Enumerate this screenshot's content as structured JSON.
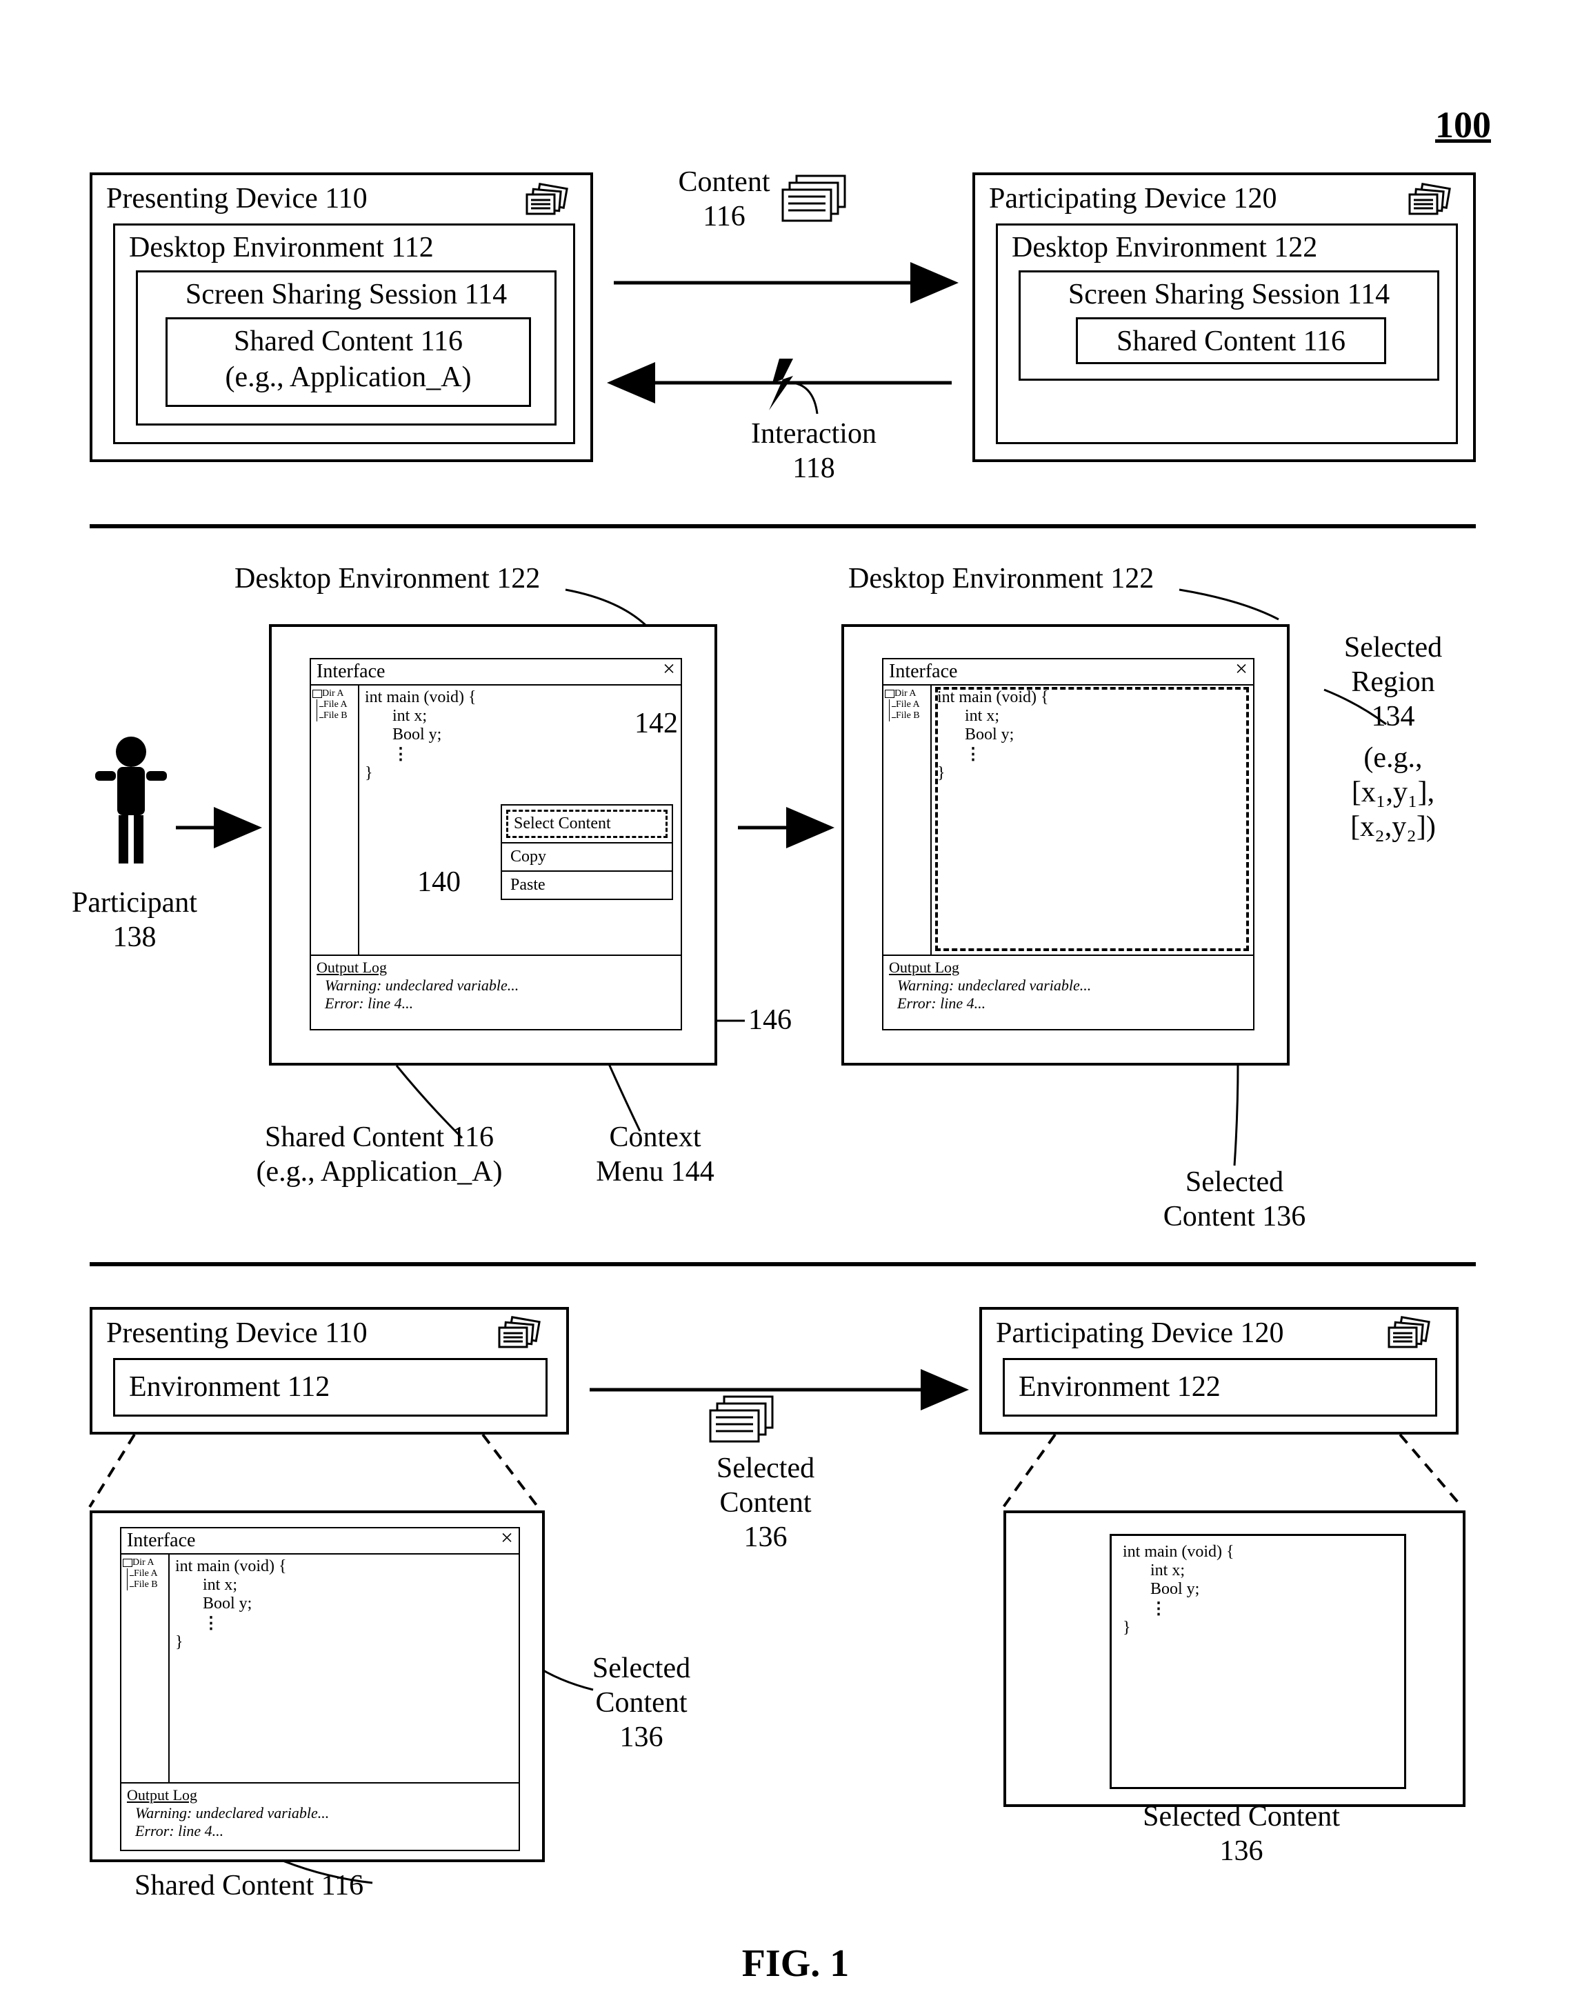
{
  "figId": "100",
  "figTitle": "FIG. 1",
  "top": {
    "presenting": {
      "title": "Presenting Device 110",
      "env": "Desktop Environment 112",
      "session": "Screen Sharing Session 114",
      "shared": "Shared Content 116",
      "sharedEg": "(e.g., Application_A)"
    },
    "participating": {
      "title": "Participating Device 120",
      "env": "Desktop Environment 122",
      "session": "Screen Sharing Session 114",
      "shared": "Shared Content 116"
    },
    "content": "Content",
    "contentNum": "116",
    "interaction": "Interaction",
    "interactionNum": "118"
  },
  "mid": {
    "envLeft": "Desktop Environment 122",
    "envRight": "Desktop Environment 122",
    "participant": "Participant",
    "participantNum": "138",
    "sharedContent": "Shared Content 116",
    "sharedContentEg": "(e.g., Application_A)",
    "ctxMenu": "Context",
    "ctxMenuB": "Menu 144",
    "selRegion1": "Selected",
    "selRegion2": "Region",
    "selRegionNum": "134",
    "selRegionEg1": "(e.g.,",
    "selRegionEg2": "[x₁,y₁],",
    "selRegionEg3": "[x₂,y₂])",
    "selContent": "Selected",
    "selContentB": "Content 136",
    "n140": "140",
    "n142": "142",
    "n146": "146",
    "iface": {
      "title": "Interface",
      "close": "×",
      "code1": "int main (void) {",
      "code2": "int x;",
      "code3": "Bool y;",
      "codeEnd": "}",
      "log1": "Output Log",
      "log2": "Warning: undeclared variable...",
      "log3": "Error: line 4...",
      "tree1": "Dir A",
      "tree2": "File A",
      "tree3": "File B",
      "menu1": "Select Content",
      "menu2": "Copy",
      "menu3": "Paste"
    }
  },
  "bot": {
    "presentingTitle": "Presenting Device 110",
    "presentingEnv": "Environment 112",
    "participatingTitle": "Participating Device 120",
    "participatingEnv": "Environment 122",
    "selContent": "Selected",
    "selContentL2": "Content",
    "selContentNum": "136",
    "selContentR": "Selected Content",
    "selContentRNum": "136",
    "sharedContent": "Shared Content 116"
  }
}
